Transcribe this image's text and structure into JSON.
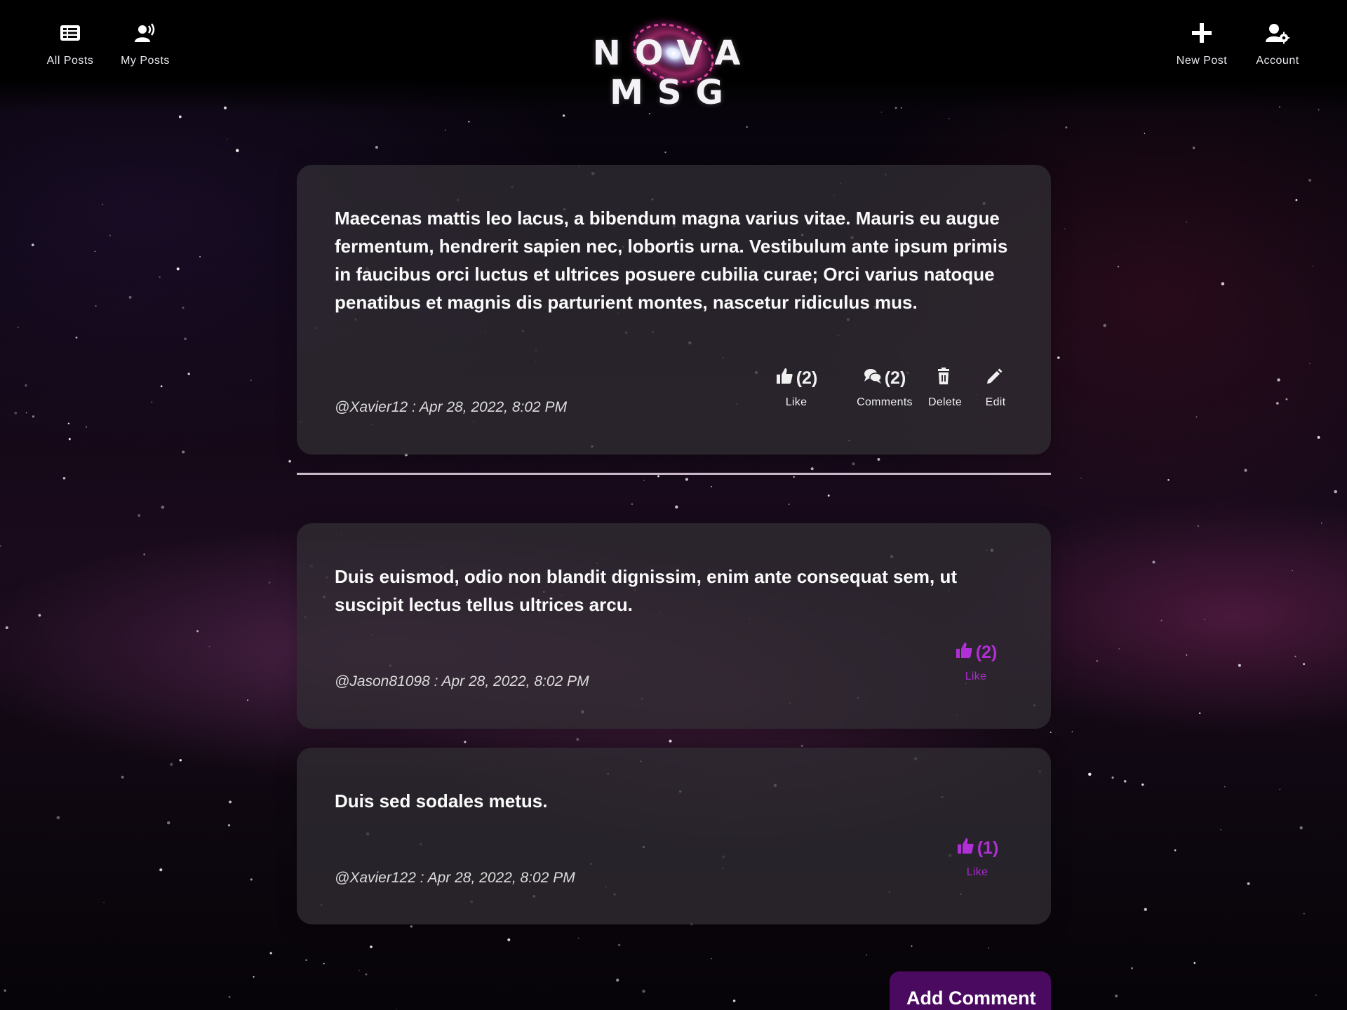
{
  "header": {
    "nav_left": [
      {
        "label": "All Posts",
        "icon": "list-icon"
      },
      {
        "label": "My Posts",
        "icon": "user-broadcast-icon"
      }
    ],
    "logo_text": "NOVA MSG",
    "nav_right": [
      {
        "label": "New Post",
        "icon": "plus-icon"
      },
      {
        "label": "Account",
        "icon": "user-gear-icon"
      }
    ]
  },
  "post": {
    "text": "Maecenas mattis leo lacus, a bibendum magna varius vitae. Mauris eu augue fermentum, hendrerit sapien nec, lobortis urna. Vestibulum ante ipsum primis in faucibus orci luctus et ultrices posuere cubilia curae; Orci varius natoque penatibus et magnis dis parturient montes, nascetur ridiculus mus.",
    "meta": "@Xavier12 : Apr 28, 2022, 8:02 PM",
    "like_count": "(2)",
    "like_label": "Like",
    "comments_count": "(2)",
    "comments_label": "Comments",
    "delete_label": "Delete",
    "edit_label": "Edit"
  },
  "comments": [
    {
      "text": "Duis euismod, odio non blandit dignissim, enim ante consequat sem, ut suscipit lectus tellus ultrices arcu.",
      "meta": "@Jason81098 : Apr 28, 2022, 8:02 PM",
      "like_count": "(2)",
      "like_label": "Like"
    },
    {
      "text": "Duis sed sodales metus.",
      "meta": "@Xavier122 : Apr 28, 2022, 8:02 PM",
      "like_count": "(1)",
      "like_label": "Like"
    }
  ],
  "add_comment_label": "Add Comment",
  "colors": {
    "accent": "#b12fd6",
    "button": "#4a0a60",
    "card": "#302c32"
  }
}
